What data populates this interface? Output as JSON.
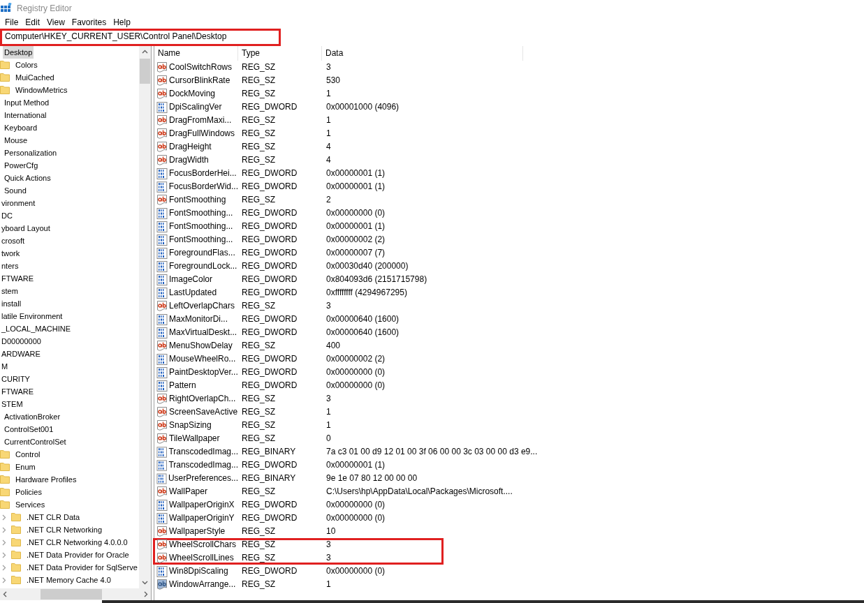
{
  "window": {
    "title": "Registry Editor"
  },
  "menu": [
    "File",
    "Edit",
    "View",
    "Favorites",
    "Help"
  ],
  "address": {
    "value": "Computer\\HKEY_CURRENT_USER\\Control Panel\\Desktop",
    "highlighted": true
  },
  "tree": [
    {
      "children": [
        {
          "children": [
            {
              "label": "Desktop",
              "selected": true,
              "children": [
                {
                  "label": "Colors",
                  "selected": false
                },
                {
                  "label": "MuiCached",
                  "selected": false
                },
                {
                  "label": "WindowMetrics",
                  "selected": false
                }
              ]
            },
            {
              "label": "Input Method",
              "selected": false
            },
            {
              "label": "International",
              "selected": false
            },
            {
              "label": "Keyboard",
              "selected": false
            },
            {
              "label": "Mouse",
              "selected": false
            },
            {
              "label": "Personalization",
              "selected": false
            },
            {
              "label": "PowerCfg",
              "selected": false
            },
            {
              "label": "Quick Actions",
              "selected": false
            },
            {
              "label": "Sound",
              "selected": false
            }
          ]
        },
        {
          "label": "vironment",
          "selected": false
        },
        {
          "label": "DC",
          "selected": false
        },
        {
          "label": "yboard Layout",
          "selected": false
        },
        {
          "label": "crosoft",
          "selected": false
        },
        {
          "label": "twork",
          "selected": false
        },
        {
          "label": "nters",
          "selected": false
        },
        {
          "label": "FTWARE",
          "selected": false
        },
        {
          "label": "stem",
          "selected": false
        },
        {
          "label": "install",
          "selected": false
        },
        {
          "label": "latile Environment",
          "selected": false
        }
      ]
    },
    {
      "label": "_LOCAL_MACHINE",
      "selected": false,
      "children": [
        {
          "label": "D00000000",
          "selected": false
        },
        {
          "label": "ARDWARE",
          "selected": false
        },
        {
          "label": "M",
          "selected": false
        },
        {
          "label": "CURITY",
          "selected": false
        },
        {
          "label": "FTWARE",
          "selected": false
        },
        {
          "label": "STEM",
          "selected": false,
          "children": [
            {
              "label": "ActivationBroker",
              "selected": false
            },
            {
              "label": "ControlSet001",
              "selected": false
            },
            {
              "label": "CurrentControlSet",
              "selected": false,
              "children": [
                {
                  "label": "Control",
                  "selected": false
                },
                {
                  "label": "Enum",
                  "selected": false
                },
                {
                  "label": "Hardware Profiles",
                  "selected": false
                },
                {
                  "label": "Policies",
                  "selected": false
                },
                {
                  "label": "Services",
                  "selected": false,
                  "children": [
                    {
                      "label": ".NET CLR Data",
                      "expanded": false,
                      "selected": false
                    },
                    {
                      "label": ".NET CLR Networking",
                      "expanded": false,
                      "selected": false
                    },
                    {
                      "label": ".NET CLR Networking 4.0.0.0",
                      "expanded": false,
                      "selected": false
                    },
                    {
                      "label": ".NET Data Provider for Oracle",
                      "expanded": false,
                      "selected": false
                    },
                    {
                      "label": ".NET Data Provider for SqlServe",
                      "expanded": false,
                      "selected": false
                    },
                    {
                      "label": ".NET Memory Cache 4.0",
                      "expanded": false,
                      "selected": false
                    }
                  ]
                }
              ]
            }
          ]
        }
      ]
    }
  ],
  "table": {
    "columns": [
      "Name",
      "Type",
      "Data"
    ],
    "rows": [
      {
        "kind": "string",
        "name": "CoolSwitchRows",
        "type": "REG_SZ",
        "data": "3",
        "selected": false,
        "highlighted": false
      },
      {
        "kind": "string",
        "name": "CursorBlinkRate",
        "type": "REG_SZ",
        "data": "530",
        "selected": false,
        "highlighted": false
      },
      {
        "kind": "string",
        "name": "DockMoving",
        "type": "REG_SZ",
        "data": "1",
        "selected": false,
        "highlighted": false
      },
      {
        "kind": "binary",
        "name": "DpiScalingVer",
        "type": "REG_DWORD",
        "data": "0x00001000 (4096)",
        "selected": false,
        "highlighted": false
      },
      {
        "kind": "string",
        "name": "DragFromMaxi...",
        "type": "REG_SZ",
        "data": "1",
        "selected": false,
        "highlighted": false
      },
      {
        "kind": "string",
        "name": "DragFullWindows",
        "type": "REG_SZ",
        "data": "1",
        "selected": false,
        "highlighted": false
      },
      {
        "kind": "string",
        "name": "DragHeight",
        "type": "REG_SZ",
        "data": "4",
        "selected": false,
        "highlighted": false
      },
      {
        "kind": "string",
        "name": "DragWidth",
        "type": "REG_SZ",
        "data": "4",
        "selected": false,
        "highlighted": false
      },
      {
        "kind": "binary",
        "name": "FocusBorderHei...",
        "type": "REG_DWORD",
        "data": "0x00000001 (1)",
        "selected": false,
        "highlighted": false
      },
      {
        "kind": "binary",
        "name": "FocusBorderWid...",
        "type": "REG_DWORD",
        "data": "0x00000001 (1)",
        "selected": false,
        "highlighted": false
      },
      {
        "kind": "string",
        "name": "FontSmoothing",
        "type": "REG_SZ",
        "data": "2",
        "selected": false,
        "highlighted": false
      },
      {
        "kind": "binary",
        "name": "FontSmoothing...",
        "type": "REG_DWORD",
        "data": "0x00000000 (0)",
        "selected": false,
        "highlighted": false
      },
      {
        "kind": "binary",
        "name": "FontSmoothing...",
        "type": "REG_DWORD",
        "data": "0x00000001 (1)",
        "selected": false,
        "highlighted": false
      },
      {
        "kind": "binary",
        "name": "FontSmoothing...",
        "type": "REG_DWORD",
        "data": "0x00000002 (2)",
        "selected": false,
        "highlighted": false
      },
      {
        "kind": "binary",
        "name": "ForegroundFlas...",
        "type": "REG_DWORD",
        "data": "0x00000007 (7)",
        "selected": false,
        "highlighted": false
      },
      {
        "kind": "binary",
        "name": "ForegroundLock...",
        "type": "REG_DWORD",
        "data": "0x00030d40 (200000)",
        "selected": false,
        "highlighted": false
      },
      {
        "kind": "binary",
        "name": "ImageColor",
        "type": "REG_DWORD",
        "data": "0x804093d6 (2151715798)",
        "selected": false,
        "highlighted": false
      },
      {
        "kind": "binary",
        "name": "LastUpdated",
        "type": "REG_DWORD",
        "data": "0xffffffff (4294967295)",
        "selected": false,
        "highlighted": false
      },
      {
        "kind": "string",
        "name": "LeftOverlapChars",
        "type": "REG_SZ",
        "data": "3",
        "selected": false,
        "highlighted": false
      },
      {
        "kind": "binary",
        "name": "MaxMonitorDi...",
        "type": "REG_DWORD",
        "data": "0x00000640 (1600)",
        "selected": false,
        "highlighted": false
      },
      {
        "kind": "binary",
        "name": "MaxVirtualDeskt...",
        "type": "REG_DWORD",
        "data": "0x00000640 (1600)",
        "selected": false,
        "highlighted": false
      },
      {
        "kind": "string",
        "name": "MenuShowDelay",
        "type": "REG_SZ",
        "data": "400",
        "selected": false,
        "highlighted": false
      },
      {
        "kind": "binary",
        "name": "MouseWheelRo...",
        "type": "REG_DWORD",
        "data": "0x00000002 (2)",
        "selected": false,
        "highlighted": false
      },
      {
        "kind": "binary",
        "name": "PaintDesktopVer...",
        "type": "REG_DWORD",
        "data": "0x00000000 (0)",
        "selected": false,
        "highlighted": false
      },
      {
        "kind": "binary",
        "name": "Pattern",
        "type": "REG_DWORD",
        "data": "0x00000000 (0)",
        "selected": false,
        "highlighted": false
      },
      {
        "kind": "string",
        "name": "RightOverlapCh...",
        "type": "REG_SZ",
        "data": "3",
        "selected": false,
        "highlighted": false
      },
      {
        "kind": "string",
        "name": "ScreenSaveActive",
        "type": "REG_SZ",
        "data": "1",
        "selected": false,
        "highlighted": false
      },
      {
        "kind": "string",
        "name": "SnapSizing",
        "type": "REG_SZ",
        "data": "1",
        "selected": false,
        "highlighted": false
      },
      {
        "kind": "string",
        "name": "TileWallpaper",
        "type": "REG_SZ",
        "data": "0",
        "selected": false,
        "highlighted": false
      },
      {
        "kind": "binary",
        "name": "TranscodedImag...",
        "type": "REG_BINARY",
        "data": "7a c3 01 00 d9 12 01 00 3f 06 00 00 3c 03 00 00 d3 e9...",
        "selected": false,
        "highlighted": false
      },
      {
        "kind": "binary",
        "name": "TranscodedImag...",
        "type": "REG_DWORD",
        "data": "0x00000001 (1)",
        "selected": false,
        "highlighted": false
      },
      {
        "kind": "binary",
        "name": "UserPreferences...",
        "type": "REG_BINARY",
        "data": "9e 1e 07 80 12 00 00 00",
        "selected": false,
        "highlighted": false
      },
      {
        "kind": "string",
        "name": "WallPaper",
        "type": "REG_SZ",
        "data": "C:\\Users\\hp\\AppData\\Local\\Packages\\Microsoft....",
        "selected": false,
        "highlighted": false
      },
      {
        "kind": "binary",
        "name": "WallpaperOriginX",
        "type": "REG_DWORD",
        "data": "0x00000000 (0)",
        "selected": false,
        "highlighted": false
      },
      {
        "kind": "binary",
        "name": "WallpaperOriginY",
        "type": "REG_DWORD",
        "data": "0x00000000 (0)",
        "selected": false,
        "highlighted": false
      },
      {
        "kind": "string",
        "name": "WallpaperStyle",
        "type": "REG_SZ",
        "data": "10",
        "selected": false,
        "highlighted": false
      },
      {
        "kind": "string",
        "name": "WheelScrollChars",
        "type": "REG_SZ",
        "data": "3",
        "selected": false,
        "highlighted": true
      },
      {
        "kind": "string",
        "name": "WheelScrollLines",
        "type": "REG_SZ",
        "data": "3",
        "selected": false,
        "highlighted": true
      },
      {
        "kind": "binary",
        "name": "Win8DpiScaling",
        "type": "REG_DWORD",
        "data": "0x00000000 (0)",
        "selected": false,
        "highlighted": false
      },
      {
        "kind": "string",
        "name": "WindowArrange...",
        "type": "REG_SZ",
        "data": "1",
        "selected": true,
        "highlighted": false
      }
    ]
  }
}
